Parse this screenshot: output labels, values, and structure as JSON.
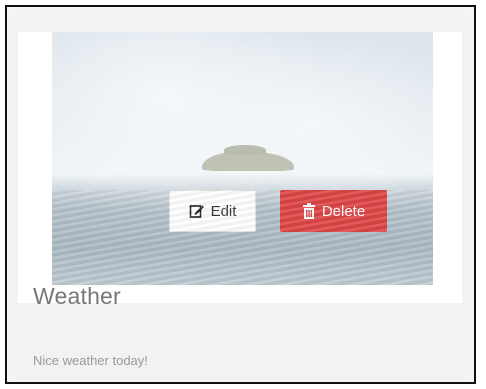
{
  "card": {
    "title": "Weather",
    "subtitle": "Nice weather today!"
  },
  "actions": {
    "edit_label": "Edit",
    "delete_label": "Delete"
  },
  "icons": {
    "edit": "edit-icon",
    "delete": "trash-icon"
  },
  "colors": {
    "delete": "#de4545",
    "edit_bg": "#ffffff",
    "title_text": "#777777"
  }
}
